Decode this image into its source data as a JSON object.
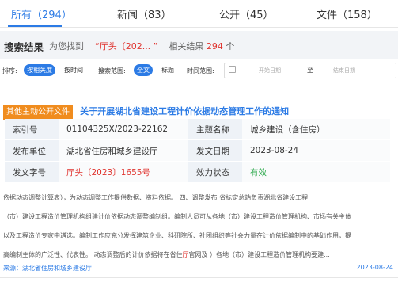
{
  "tabs": [
    {
      "label": "所有（294）"
    },
    {
      "label": "新闻（83）"
    },
    {
      "label": "公开（45）"
    },
    {
      "label": "文件（158）"
    }
  ],
  "results": {
    "title": "搜索结果",
    "prefix": "为您找到",
    "keyword": "“厅头〔202... ”",
    "middle": "相关结果",
    "count": "294",
    "suffix": "个"
  },
  "filters": {
    "sort_label": "排序:",
    "sort_options": [
      "按相关度",
      "按时间"
    ],
    "scope_label": "搜索范围:",
    "scope_options": [
      "全文",
      "标题"
    ],
    "time_label": "时间范围:",
    "date_start_placeholder": "开始日期",
    "date_separator": "至",
    "date_end_placeholder": "结束日期"
  },
  "result": {
    "tag": "其他主动公开文件",
    "title": "关于开展湖北省建设工程计价依据动态管理工作的通知",
    "meta": {
      "index_label": "索引号",
      "index_value": "01104325X/2023-22162",
      "topic_label": "主题名称",
      "topic_value": "城乡建设（含住房）",
      "publisher_label": "发布单位",
      "publisher_value": "湖北省住房和城乡建设厅",
      "date_label": "发文日期",
      "date_value": "2023-08-24",
      "docno_label": "发文字号",
      "docno_value": "厅头〔2023〕1655号",
      "status_label": "效力状态",
      "status_value": "有效"
    },
    "snippet": [
      {
        "text": "依据动态调整计算表），为动态调整工作提供数据、资料依据。      四、调整发布      省标定总站负责湖北省建设工程"
      },
      {
        "text": "（市）建设工程造价管理机构组建计价依据动态调整编制组。编制人员可从各地（市）建设工程造价管理机构、市场有关主体"
      },
      {
        "text": "以及工程造价专家中遴选。编制工作应充分发挥建筑企业、科研院所、社团组织等社会力量在计价依据编制中的基础作用，提"
      },
      {
        "text_a": "高编制主体的广泛性、代表性。      动态调整后的计价依据将在省住",
        "text_hl": "厅",
        "text_b": "官网及 ）各地（市）建设工程造价管理机构要建..."
      }
    ],
    "source": "来源：湖北省住房和城乡建设厅",
    "date": "2023-08-24"
  }
}
